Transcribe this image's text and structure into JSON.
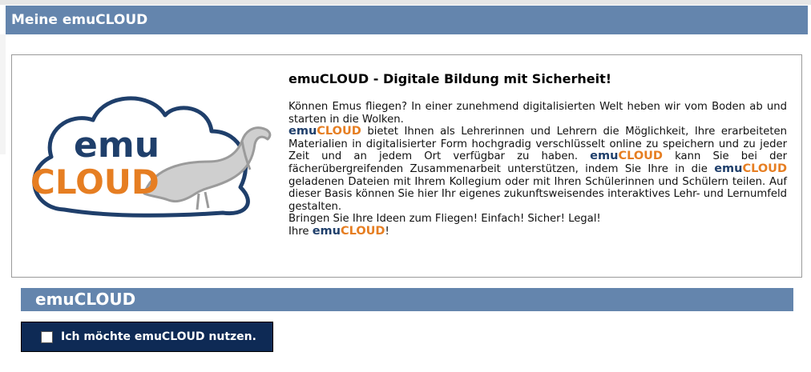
{
  "header": {
    "title": "Meine emuCLOUD"
  },
  "info": {
    "heading": "emuCLOUD - Digitale Bildung mit Sicherheit!",
    "brand_part1": "emu",
    "brand_part2": "CLOUD",
    "p1": "Können Emus fliegen? In einer zunehmend digitalisierten Welt heben wir vom Boden ab und starten in die Wolken.",
    "p2a": " bietet Ihnen als Lehrerinnen und Lehrern die Möglichkeit, Ihre erarbeiteten Materialien in digitalisierter Form hochgradig verschlüsselt online zu speichern und zu jeder Zeit und an jedem Ort verfügbar zu haben. ",
    "p2b": " kann Sie bei der fächerübergreifenden Zusammenarbeit unterstützen, indem Sie Ihre in die ",
    "p2c": " geladenen Dateien mit Ihrem Kollegium oder mit Ihren Schülerinnen und Schülern teilen. Auf dieser Basis können Sie hier Ihr eigenes zukunftsweisendes interaktives Lehr- und Lernumfeld gestalten.",
    "p3": "Bringen Sie Ihre Ideen zum Fliegen! Einfach! Sicher! Legal!",
    "p4a": "Ihre ",
    "p4b": "!"
  },
  "logo": {
    "line1": "emu",
    "line2": "CLOUD",
    "colors": {
      "blue": "#1f3f6b",
      "orange": "#e67e22",
      "grey": "#9b9b9b"
    }
  },
  "section": {
    "title": "emuCLOUD",
    "checkbox_label": "Ich möchte emuCLOUD nutzen.",
    "checked": false
  },
  "colors": {
    "bar": "#6485ad",
    "button": "#0e2a55"
  }
}
